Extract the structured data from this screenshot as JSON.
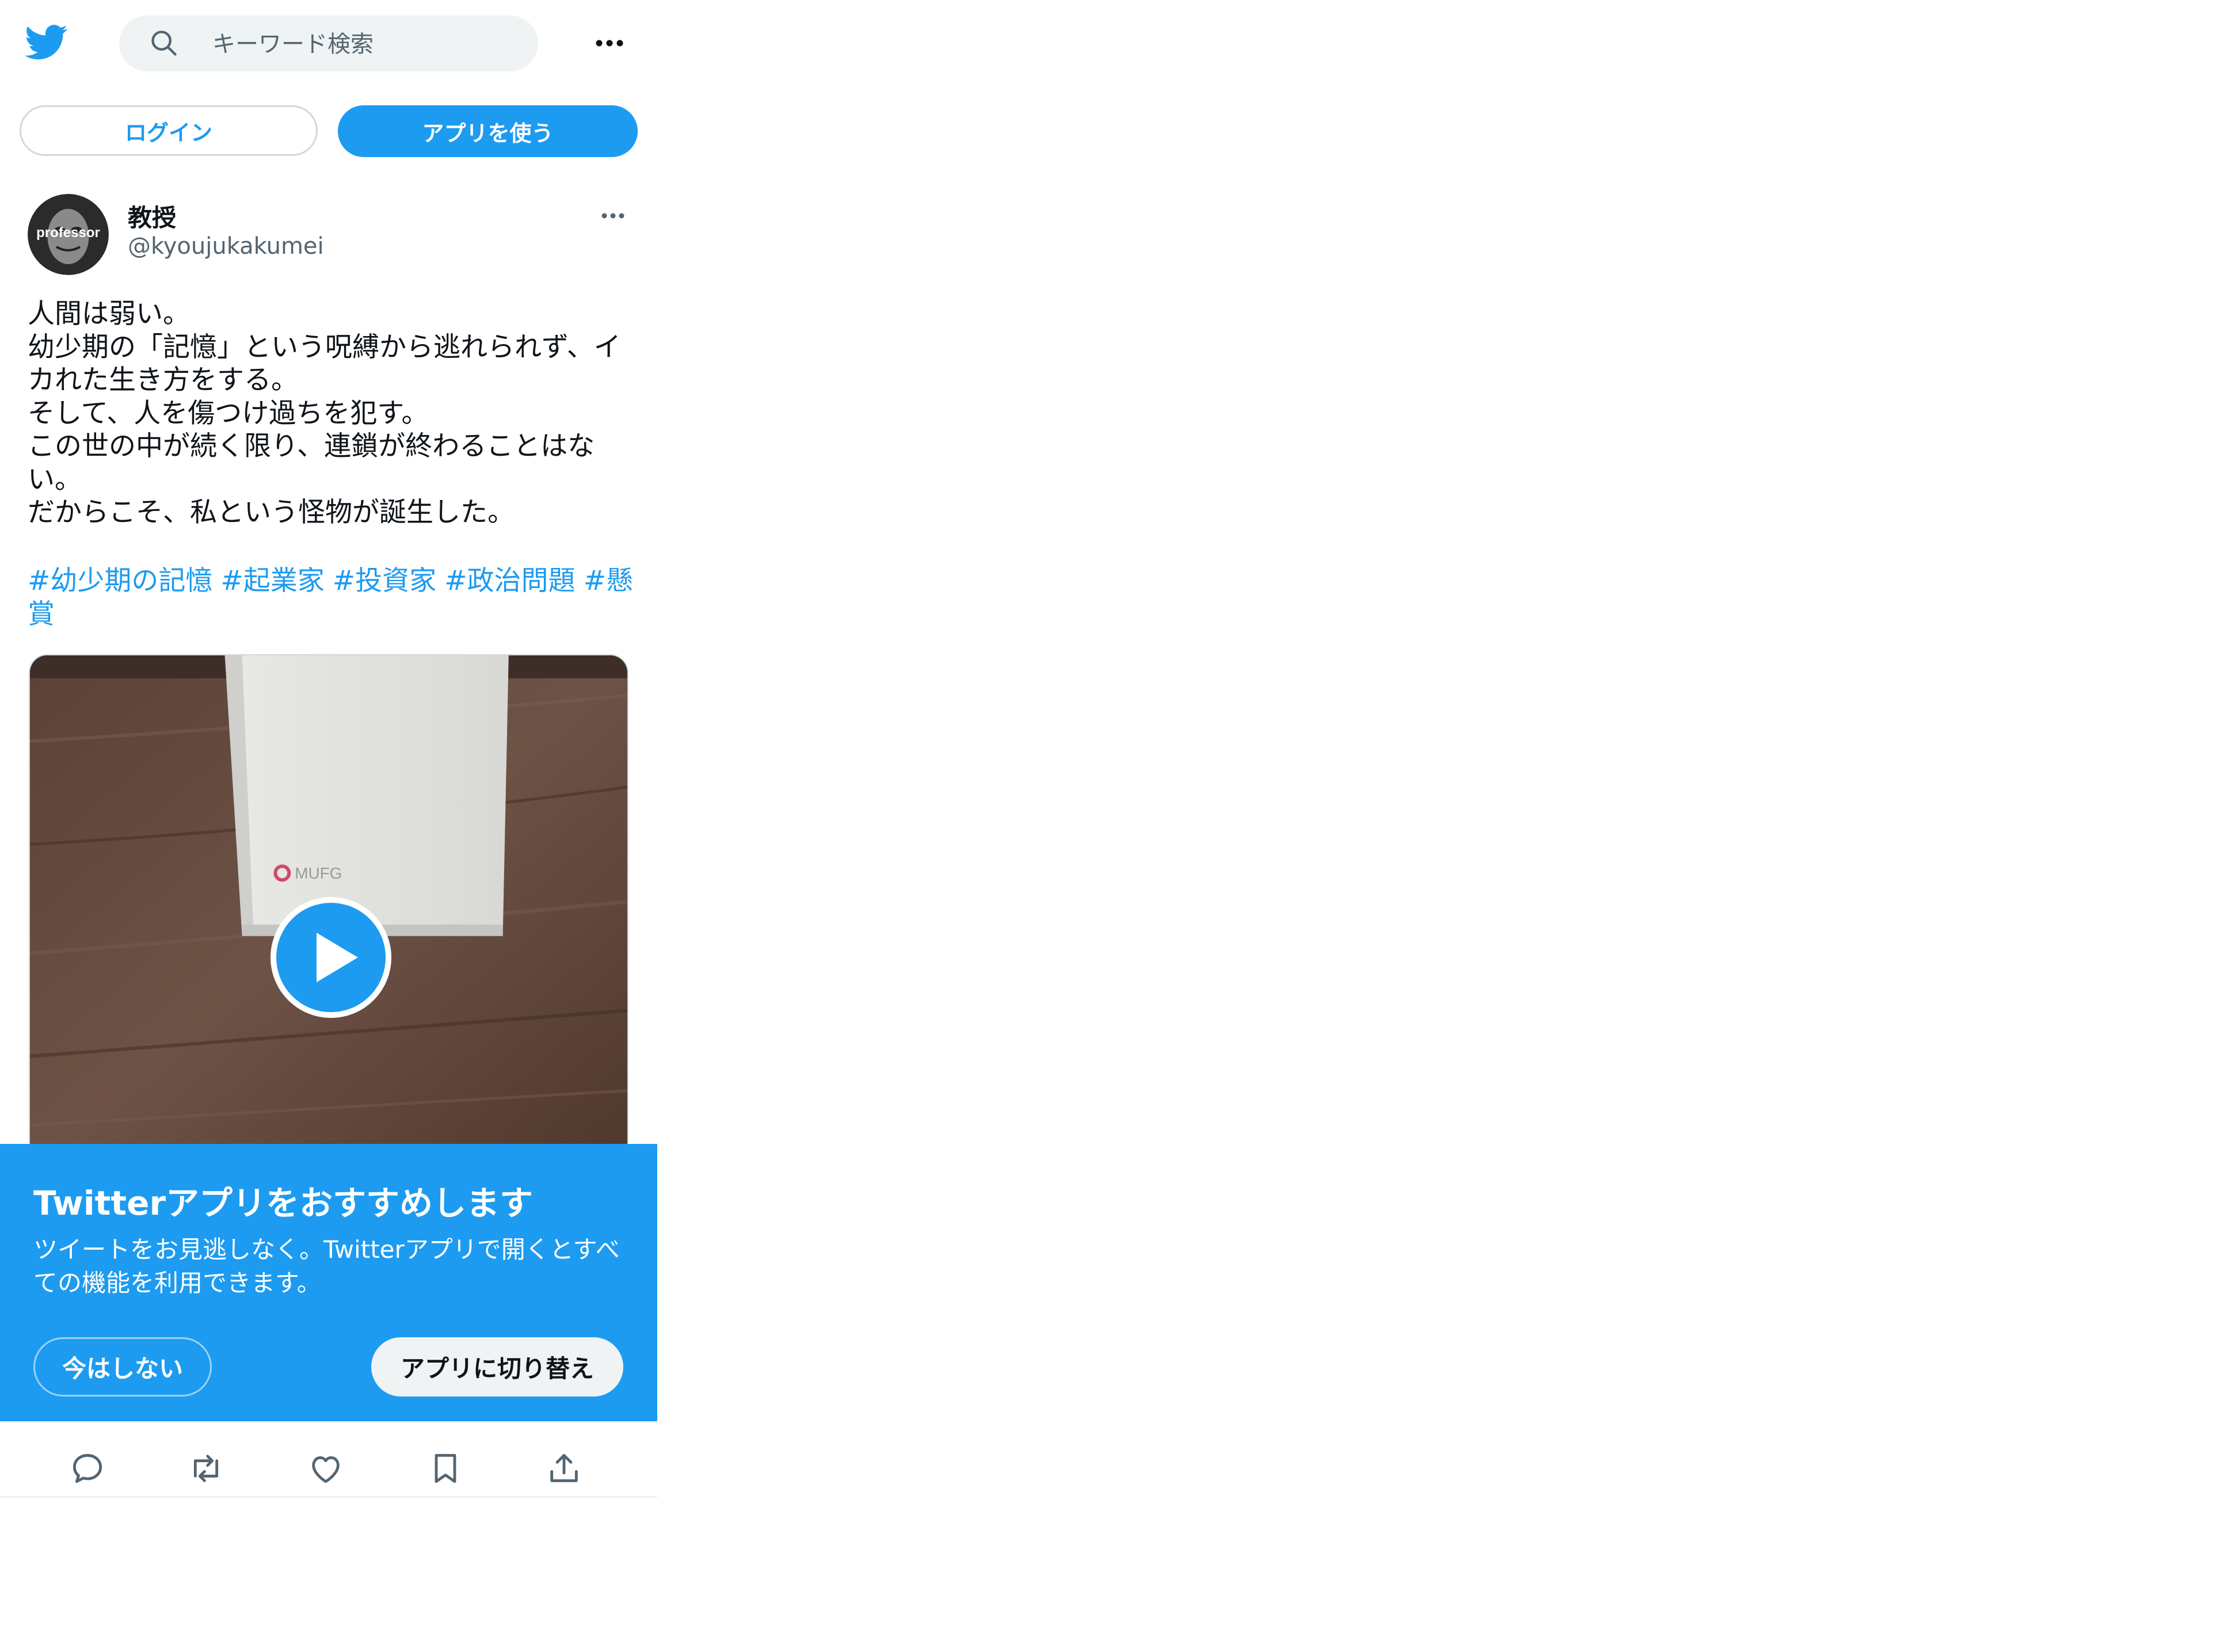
{
  "header": {
    "search_placeholder": "キーワード検索",
    "login_label": "ログイン",
    "use_app_label": "アプリを使う"
  },
  "tweet": {
    "author_name": "教授",
    "author_handle": "@kyoujukakumei",
    "avatar_text": "professor",
    "text": "人間は弱い。\n幼少期の「記憶」という呪縛から逃れられず、イカれた生き方をする。\nそして、人を傷つけ過ちを犯す。\nこの世の中が続く限り、連鎖が終わることはない。\nだからこそ、私という怪物が誕生した。",
    "hashtags": [
      "#幼少期の記憶",
      "#起業家",
      "#投資家",
      "#政治問題",
      "#懸賞"
    ],
    "media_logo_text": "MUFG"
  },
  "banner": {
    "title": "Twitterアプリをおすすめします",
    "description": "ツイートをお見逃しなく。Twitterアプリで開くとすべての機能を利用できます。",
    "not_now_label": "今はしない",
    "switch_label": "アプリに切り替え"
  },
  "icons": {
    "logo": "twitter-bird-icon",
    "search": "search-icon",
    "more": "more-horizontal-icon",
    "reply": "reply-icon",
    "retweet": "retweet-icon",
    "like": "heart-icon",
    "bookmark": "bookmark-icon",
    "share": "share-icon",
    "play": "play-icon"
  },
  "colors": {
    "accent": "#1d9bf0",
    "text": "#0f1419",
    "secondary": "#536471"
  }
}
